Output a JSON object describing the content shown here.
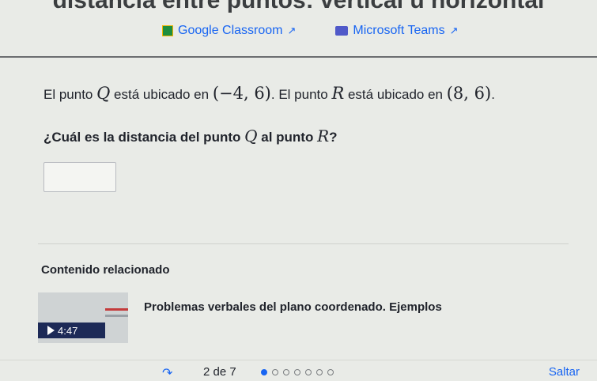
{
  "page": {
    "title": "distancia entre puntos: vertical u horizontal"
  },
  "share": {
    "classroom_label": "Google Classroom",
    "teams_label": "Microsoft Teams"
  },
  "problem": {
    "p1": "El punto ",
    "q": "Q",
    "p2": " está ubicado en ",
    "coord_q": "(−4, 6)",
    "p3": ". El punto ",
    "r": "R",
    "p4": " está ubicado en ",
    "coord_r": "(8, 6)",
    "p5": "."
  },
  "question": {
    "p1": "¿Cuál es la distancia del punto ",
    "q": "Q",
    "p2": " al punto ",
    "r": "R",
    "p3": "?"
  },
  "answer": {
    "value": ""
  },
  "related": {
    "heading": "Contenido relacionado",
    "video_title": "Problemas verbales del plano coordenado. Ejemplos",
    "duration": "4:47"
  },
  "footer": {
    "pager": "2 de 7",
    "current_page": 2,
    "total_pages": 7,
    "skip_label": "Saltar"
  }
}
